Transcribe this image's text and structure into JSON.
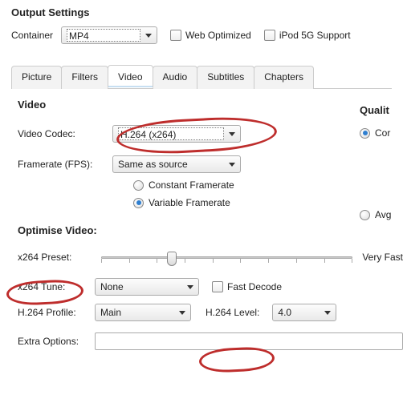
{
  "header": {
    "title": "Output Settings",
    "container_label": "Container",
    "container_value": "MP4",
    "web_optimized_label": "Web Optimized",
    "ipod_label": "iPod 5G Support"
  },
  "tabs": {
    "items": [
      {
        "label": "Picture"
      },
      {
        "label": "Filters"
      },
      {
        "label": "Video"
      },
      {
        "label": "Audio"
      },
      {
        "label": "Subtitles"
      },
      {
        "label": "Chapters"
      }
    ],
    "active": 2
  },
  "video": {
    "heading": "Video",
    "codec_label": "Video Codec:",
    "codec_value": "H.264 (x264)",
    "framerate_label": "Framerate (FPS):",
    "framerate_value": "Same as source",
    "constant_label": "Constant Framerate",
    "variable_label": "Variable Framerate"
  },
  "quality": {
    "heading_partial": "Qualit",
    "constant_radio_partial": "Cor",
    "avg_radio_partial": "Avg"
  },
  "optimise": {
    "heading": "Optimise Video:",
    "preset_label": "x264 Preset:",
    "preset_value_label": "Very Fast",
    "tune_label": "x264 Tune:",
    "tune_value": "None",
    "fast_decode_label": "Fast Decode",
    "profile_label": "H.264 Profile:",
    "profile_value": "Main",
    "level_label": "H.264 Level:",
    "level_value": "4.0",
    "extra_options_label": "Extra Options:"
  }
}
